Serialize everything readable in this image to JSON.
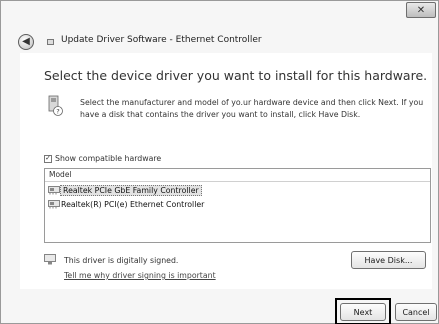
{
  "window": {
    "title": "Update Driver Software - Ethernet Controller",
    "close_label": "✕"
  },
  "main": {
    "heading": "Select the device driver you want to install for this hardware.",
    "info_text": "Select the manufacturer and model of yo.ur hardware device and then click Next. If you have a disk that contains the driver you want to install, click Have Disk."
  },
  "compat": {
    "label": "Show compatible hardware",
    "checked": true,
    "check_glyph": "✓"
  },
  "models": {
    "header": "Model",
    "items": [
      {
        "label": "Realtek PCIe GbE Family Controller",
        "selected": true
      },
      {
        "label": "Realtek(R) PCI(e) Ethernet Controller",
        "selected": false
      }
    ]
  },
  "signing": {
    "status": "This driver is digitally signed.",
    "link": "Tell me why driver signing is important"
  },
  "buttons": {
    "have_disk": "Have Disk...",
    "next": "Next",
    "cancel": "Cancel"
  },
  "icons": {
    "back": "back-arrow-icon",
    "title": "device-icon",
    "info": "driver-disk-icon",
    "driver": "network-adapter-icon",
    "signed": "signed-driver-icon"
  }
}
